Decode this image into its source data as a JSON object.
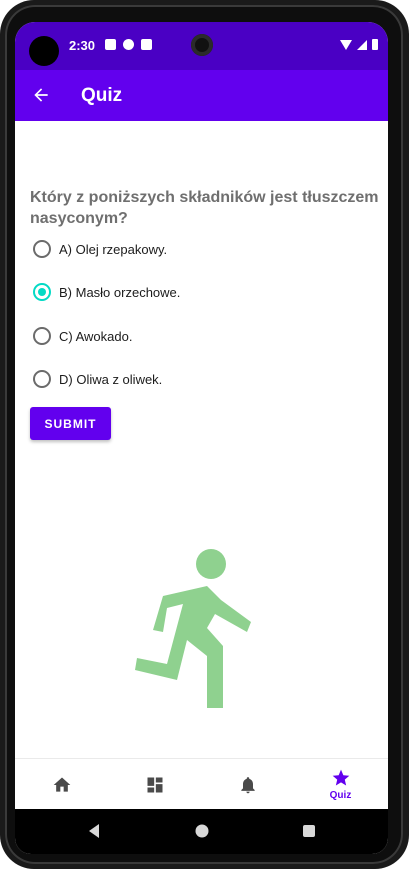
{
  "status_bar": {
    "time": "2:30"
  },
  "app_bar": {
    "title": "Quiz",
    "back_icon": "arrow-back-icon"
  },
  "question": {
    "text": "Który z poniższych składników jest tłuszczem nasyconym?"
  },
  "options": [
    {
      "label": "A) Olej rzepakowy.",
      "selected": false
    },
    {
      "label": "B) Masło orzechowe.",
      "selected": true
    },
    {
      "label": "C) Awokado.",
      "selected": false
    },
    {
      "label": "D) Oliwa z oliwek.",
      "selected": false
    }
  ],
  "submit": {
    "label": "SUBMIT"
  },
  "illustration": {
    "icon": "running-person-icon",
    "color": "#8fd18f"
  },
  "bottom_nav": {
    "items": [
      {
        "icon": "home-icon",
        "label": ""
      },
      {
        "icon": "dashboard-icon",
        "label": ""
      },
      {
        "icon": "bell-icon",
        "label": ""
      },
      {
        "icon": "star-icon",
        "label": "Quiz",
        "active": true
      }
    ]
  },
  "colors": {
    "primary": "#6200ee",
    "status_bar": "#4a00c4",
    "accent": "#03dac5",
    "question_text": "#6f6f6f"
  }
}
